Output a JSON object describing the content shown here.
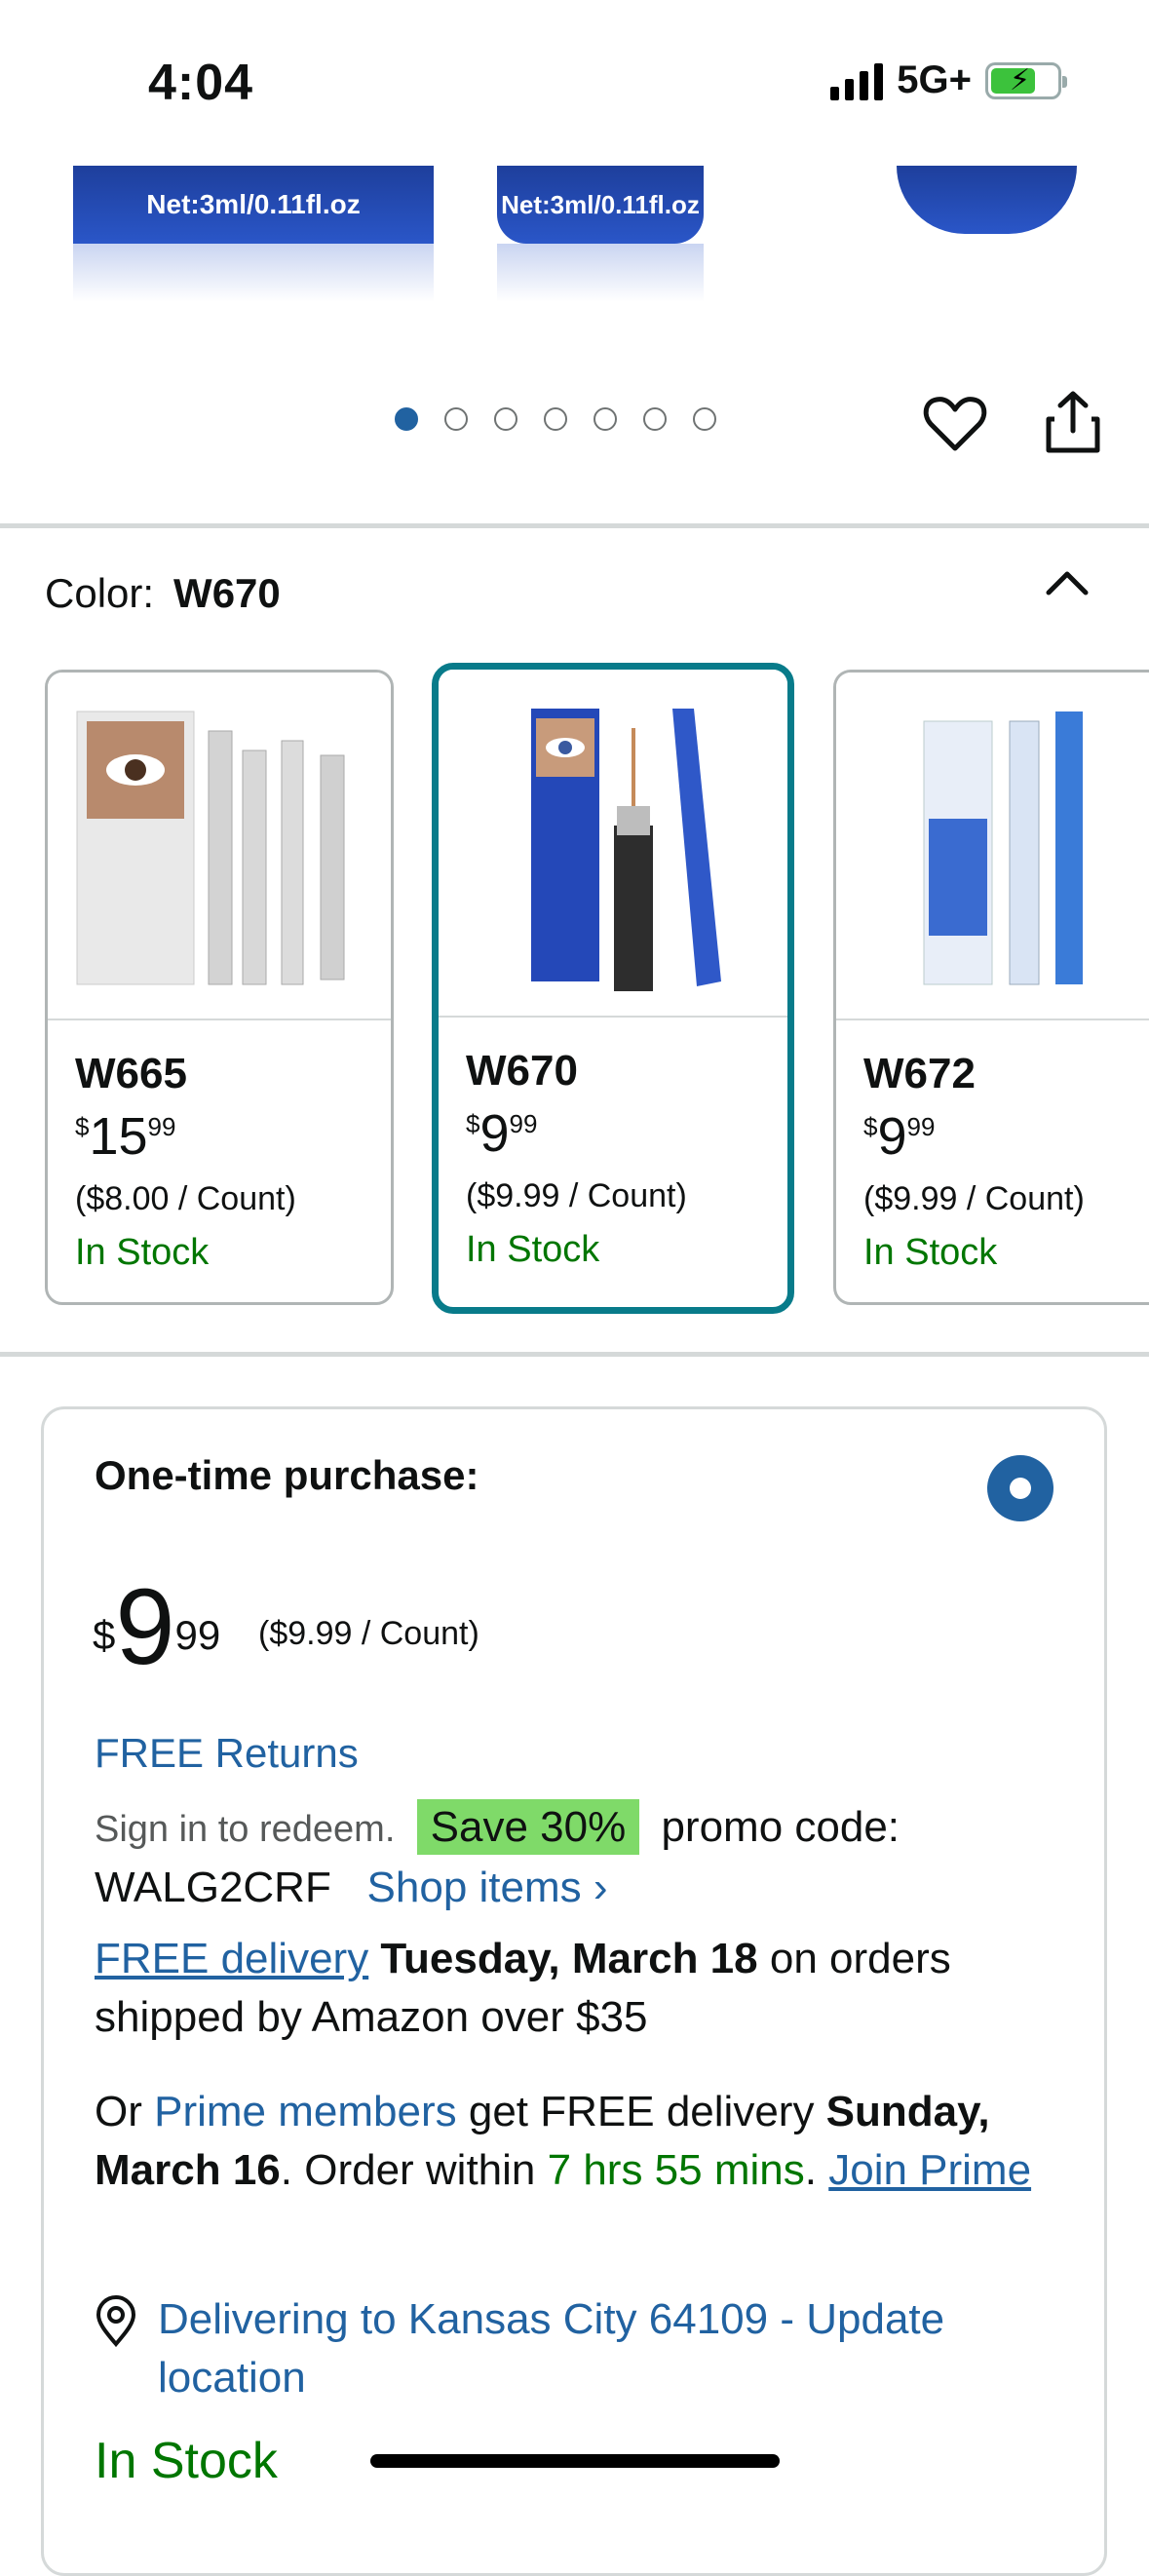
{
  "status_bar": {
    "time": "4:04",
    "network": "5G+"
  },
  "gallery": {
    "visible_labels": [
      "Net:3ml/0.11fl.oz",
      "Net:3ml/0.11fl.oz"
    ],
    "dot_count": 7,
    "active_dot": 1
  },
  "color_selector": {
    "label": "Color:",
    "selected": "W670",
    "options": [
      {
        "name": "W665",
        "currency": "$",
        "price_whole": "15",
        "price_cents": "99",
        "unit_price": "($8.00 / Count)",
        "stock": "In Stock"
      },
      {
        "name": "W670",
        "currency": "$",
        "price_whole": "9",
        "price_cents": "99",
        "unit_price": "($9.99 / Count)",
        "stock": "In Stock"
      },
      {
        "name": "W672",
        "currency": "$",
        "price_whole": "9",
        "price_cents": "99",
        "unit_price": "($9.99 / Count)",
        "stock": "In Stock"
      }
    ]
  },
  "purchase": {
    "title": "One-time purchase:",
    "currency": "$",
    "price_whole": "9",
    "price_cents": "99",
    "unit_price": "($9.99 / Count)",
    "free_returns": "FREE Returns",
    "promo_prefix": "Sign in to redeem.",
    "promo_badge": "Save 30%",
    "promo_suffix": "promo code:",
    "promo_code": "WALG2CRF",
    "shop_items": "Shop items ›",
    "delivery_link": "FREE delivery",
    "delivery_date": "Tuesday, March 18",
    "delivery_rest": "on orders shipped by Amazon over $35",
    "prime_or": "Or",
    "prime_members": "Prime members",
    "prime_get": "get FREE delivery",
    "prime_date": "Sunday, March 16",
    "prime_order": ". Order within",
    "prime_countdown": "7 hrs 55 mins",
    "prime_dot": ".",
    "join_prime": "Join Prime",
    "location": "Delivering to Kansas City 64109 - Update location",
    "stock": "In Stock"
  },
  "colors": {
    "link": "#2162a1",
    "green": "#007600",
    "selected_border": "#087b8a",
    "promo_badge": "#7fda69"
  }
}
